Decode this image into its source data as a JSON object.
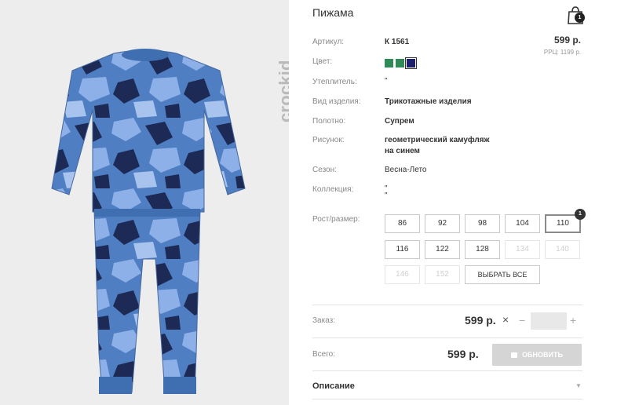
{
  "brand": {
    "logo_text": "crockid",
    "bg": "#ededed",
    "logo_color": "#b9b9b9"
  },
  "product": {
    "title": "Пижама",
    "cart_count": "1",
    "price": "599 р.",
    "rrp": "РРЦ: 1199 р.",
    "attributes": [
      {
        "label": "Артикул:",
        "value": "К 1561",
        "bold": true
      },
      {
        "label": "Цвет:",
        "value": ""
      },
      {
        "label": "Утеплитель:",
        "value": "\""
      },
      {
        "label": "Вид изделия:",
        "value": "Трикотажные изделия",
        "bold": true
      },
      {
        "label": "Полотно:",
        "value": "Супрем",
        "bold": true
      },
      {
        "label": "Рисунок:",
        "value_lines": [
          "геометрический камуфляж",
          "на синем"
        ],
        "bold": true
      },
      {
        "label": "Сезон:",
        "value": "Весна-Лето"
      },
      {
        "label": "Коллекция:",
        "value_lines": [
          "\"",
          "\""
        ]
      }
    ],
    "color_swatches": [
      {
        "color": "#2e8b57",
        "selected": false
      },
      {
        "color": "#2e8b57",
        "selected": false
      },
      {
        "color": "#1b1f6e",
        "selected": true
      }
    ]
  },
  "sizes": {
    "label": "Рост/размер:",
    "items": [
      {
        "label": "86",
        "state": "enabled"
      },
      {
        "label": "92",
        "state": "enabled"
      },
      {
        "label": "98",
        "state": "enabled"
      },
      {
        "label": "104",
        "state": "enabled"
      },
      {
        "label": "110",
        "state": "selected",
        "badge": "1"
      },
      {
        "label": "116",
        "state": "enabled"
      },
      {
        "label": "122",
        "state": "enabled"
      },
      {
        "label": "128",
        "state": "enabled"
      },
      {
        "label": "134",
        "state": "disabled"
      },
      {
        "label": "140",
        "state": "disabled"
      },
      {
        "label": "146",
        "state": "disabled"
      },
      {
        "label": "152",
        "state": "disabled"
      }
    ],
    "select_all_label": "ВЫБРАТЬ ВСЕ"
  },
  "order": {
    "label": "Заказ:",
    "price": "599 р.",
    "times": "×",
    "minus": "−",
    "plus": "+",
    "quantity": ""
  },
  "total": {
    "label": "Всего:",
    "value": "599 р.",
    "update_label": "ОБНОВИТЬ"
  },
  "description": {
    "label": "Описание"
  },
  "icons": {
    "cart": "shopping-bag-icon",
    "chevron": "chevron-down-icon",
    "basket": "basket-icon"
  },
  "colors": {
    "text": "#333333",
    "muted": "#888888",
    "pajama_light": "#7fa6e0",
    "pajama_mid": "#4f7fc2",
    "pajama_dark": "#1c2a55"
  }
}
